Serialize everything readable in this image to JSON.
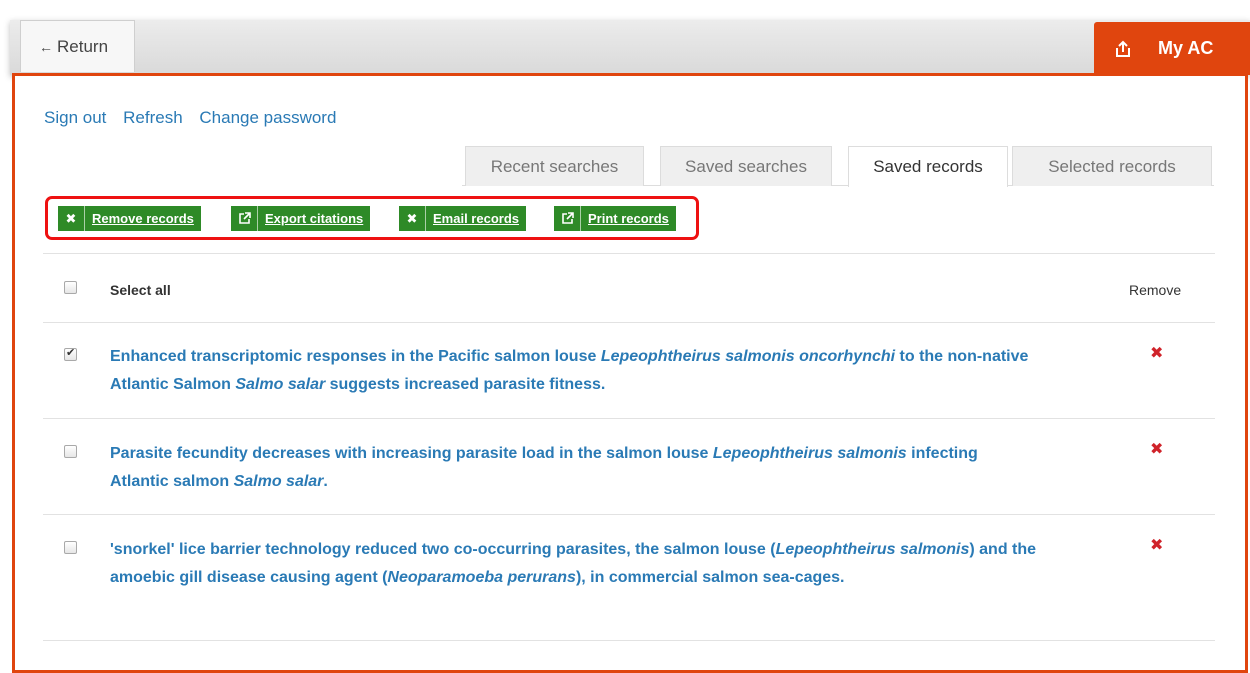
{
  "header": {
    "return_label": "Return",
    "myac_label": "My AC",
    "accent_color": "#e0450e"
  },
  "account_links": [
    "Sign out",
    "Refresh",
    "Change password"
  ],
  "tabs": [
    {
      "label": "Recent searches",
      "active": false
    },
    {
      "label": "Saved searches",
      "active": false
    },
    {
      "label": "Saved records",
      "active": true
    },
    {
      "label": "Selected records",
      "active": false
    }
  ],
  "actions": [
    {
      "label": "Remove records",
      "icon": "close-icon"
    },
    {
      "label": "Export citations",
      "icon": "external-link-icon"
    },
    {
      "label": "Email records",
      "icon": "close-icon"
    },
    {
      "label": "Print records",
      "icon": "external-link-icon"
    }
  ],
  "table": {
    "select_all_label": "Select all",
    "remove_header": "Remove",
    "records": [
      {
        "checked": true,
        "segments": [
          {
            "t": "Enhanced transcriptomic responses in the Pacific salmon louse ",
            "i": false
          },
          {
            "t": "Lepeophtheirus salmonis oncorhynchi",
            "i": true
          },
          {
            "t": " to the non-native Atlantic Salmon ",
            "i": false
          },
          {
            "t": "Salmo salar",
            "i": true
          },
          {
            "t": " suggests increased parasite fitness.",
            "i": false
          }
        ]
      },
      {
        "checked": false,
        "segments": [
          {
            "t": "Parasite fecundity decreases with increasing parasite load in the salmon louse ",
            "i": false
          },
          {
            "t": "Lepeophtheirus salmonis",
            "i": true
          },
          {
            "t": " infecting Atlantic salmon ",
            "i": false
          },
          {
            "t": "Salmo salar",
            "i": true
          },
          {
            "t": ".",
            "i": false
          }
        ]
      },
      {
        "checked": false,
        "segments": [
          {
            "t": "'snorkel' lice barrier technology reduced two co-occurring parasites, the salmon louse (",
            "i": false
          },
          {
            "t": "Lepeophtheirus salmonis",
            "i": true
          },
          {
            "t": ") and the amoebic gill disease causing agent (",
            "i": false
          },
          {
            "t": "Neoparamoeba perurans",
            "i": true
          },
          {
            "t": "), in commercial salmon sea-cages.",
            "i": false
          }
        ]
      }
    ]
  }
}
